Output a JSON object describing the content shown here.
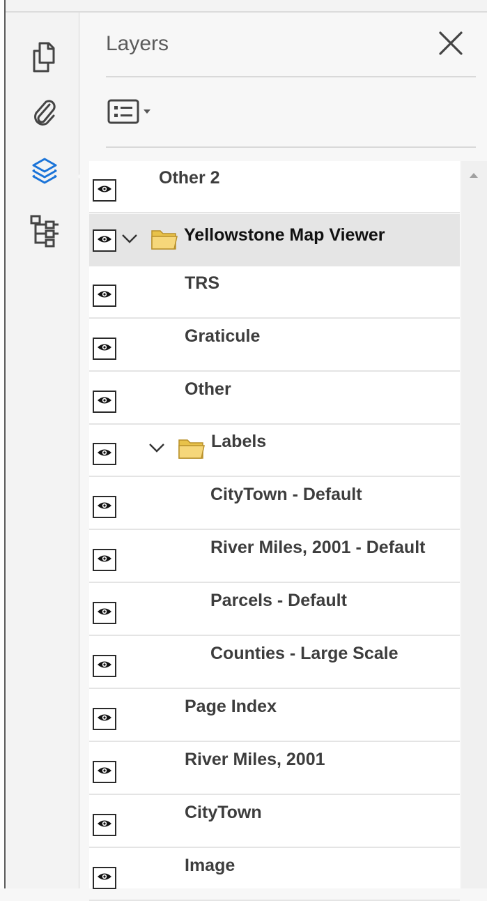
{
  "rail": {
    "items": [
      {
        "name": "pages-thumbnails",
        "icon": "pages-icon",
        "active": false
      },
      {
        "name": "attachments",
        "icon": "paperclip-icon",
        "active": false
      },
      {
        "name": "layers",
        "icon": "layers-icon",
        "active": true
      },
      {
        "name": "structure",
        "icon": "tree-structure-icon",
        "active": false
      }
    ],
    "active_color": "#1a73d8"
  },
  "panel": {
    "title": "Layers",
    "close_icon": "close-icon",
    "options_icon": "list-options-icon"
  },
  "layers": [
    {
      "label": "Other 2",
      "visible": true,
      "level": 0,
      "group": false
    },
    {
      "label": "Yellowstone Map Viewer",
      "visible": true,
      "level": 0,
      "group": true,
      "expanded": true,
      "selected": true
    },
    {
      "label": "TRS",
      "visible": true,
      "level": 1,
      "group": false
    },
    {
      "label": "Graticule",
      "visible": true,
      "level": 1,
      "group": false
    },
    {
      "label": "Other",
      "visible": true,
      "level": 1,
      "group": false
    },
    {
      "label": "Labels",
      "visible": true,
      "level": 1,
      "group": true,
      "expanded": true
    },
    {
      "label": "CityTown - Default",
      "visible": true,
      "level": 2,
      "group": false
    },
    {
      "label": "River Miles, 2001 - Default",
      "visible": true,
      "level": 2,
      "group": false
    },
    {
      "label": "Parcels - Default",
      "visible": true,
      "level": 2,
      "group": false
    },
    {
      "label": "Counties - Large Scale",
      "visible": true,
      "level": 2,
      "group": false
    },
    {
      "label": "Page Index",
      "visible": true,
      "level": 1,
      "group": false
    },
    {
      "label": "River Miles, 2001",
      "visible": true,
      "level": 1,
      "group": false
    },
    {
      "label": "CityTown",
      "visible": true,
      "level": 1,
      "group": false
    },
    {
      "label": "Image",
      "visible": true,
      "level": 1,
      "group": false
    }
  ]
}
